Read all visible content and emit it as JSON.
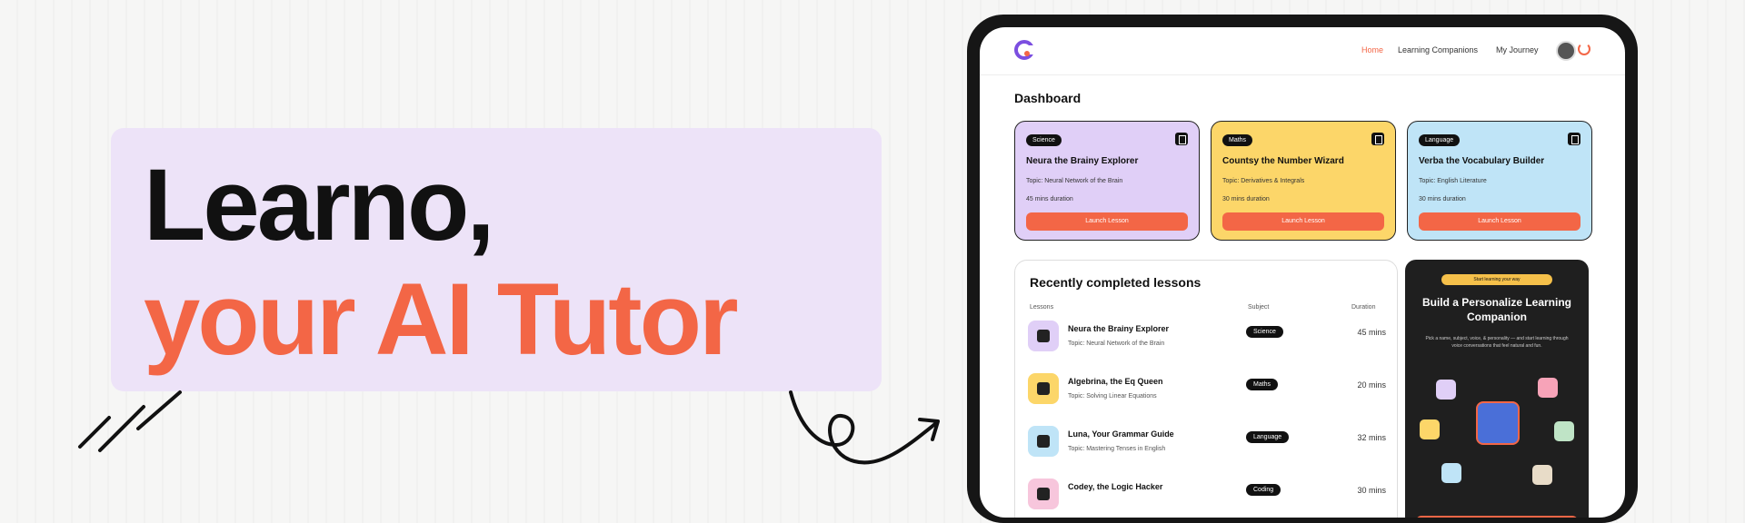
{
  "hero": {
    "line1": "Learno,",
    "line2": "your AI Tutor",
    "accent_color": "#f36646",
    "box_color": "#ede3f8"
  },
  "app": {
    "nav": {
      "links": [
        "Home",
        "Learning Companions",
        "My Journey"
      ],
      "active": "Home"
    },
    "dashboard_title": "Dashboard",
    "cards": [
      {
        "tag": "Science",
        "title": "Neura the Brainy Explorer",
        "topic": "Topic: Neural Network of the Brain",
        "duration": "45 mins duration",
        "button": "Launch Lesson",
        "color": "#e0cff7"
      },
      {
        "tag": "Maths",
        "title": "Countsy the Number Wizard",
        "topic": "Topic: Derivatives & Integrals",
        "duration": "30 mins duration",
        "button": "Launch Lesson",
        "color": "#fcd669"
      },
      {
        "tag": "Language",
        "title": "Verba the Vocabulary Builder",
        "topic": "Topic: English Literature",
        "duration": "30 mins duration",
        "button": "Launch Lesson",
        "color": "#bfe4f7"
      }
    ],
    "recent": {
      "title": "Recently completed lessons",
      "headers": {
        "lessons": "Lessons",
        "subject": "Subject",
        "duration": "Duration"
      },
      "rows": [
        {
          "name": "Neura the Brainy Explorer",
          "topic": "Topic: Neural Network of the Brain",
          "subject": "Science",
          "duration": "45 mins",
          "icon_color": "#e0cff7"
        },
        {
          "name": "Algebrina, the Eq Queen",
          "topic": "Topic: Solving Linear Equations",
          "subject": "Maths",
          "duration": "20 mins",
          "icon_color": "#fcd669"
        },
        {
          "name": "Luna, Your Grammar Guide",
          "topic": "Topic: Mastering Tenses in English",
          "subject": "Language",
          "duration": "32 mins",
          "icon_color": "#bfe4f7"
        },
        {
          "name": "Codey, the Logic Hacker",
          "topic": "",
          "subject": "Coding",
          "duration": "30 mins",
          "icon_color": "#f7c6dc"
        }
      ]
    },
    "promo": {
      "badge": "Start learning your way",
      "title": "Build a Personalize Learning Companion",
      "description": "Pick a name, subject, voice, & personality — and start learning through voice conversations that feel natural and fun."
    }
  }
}
